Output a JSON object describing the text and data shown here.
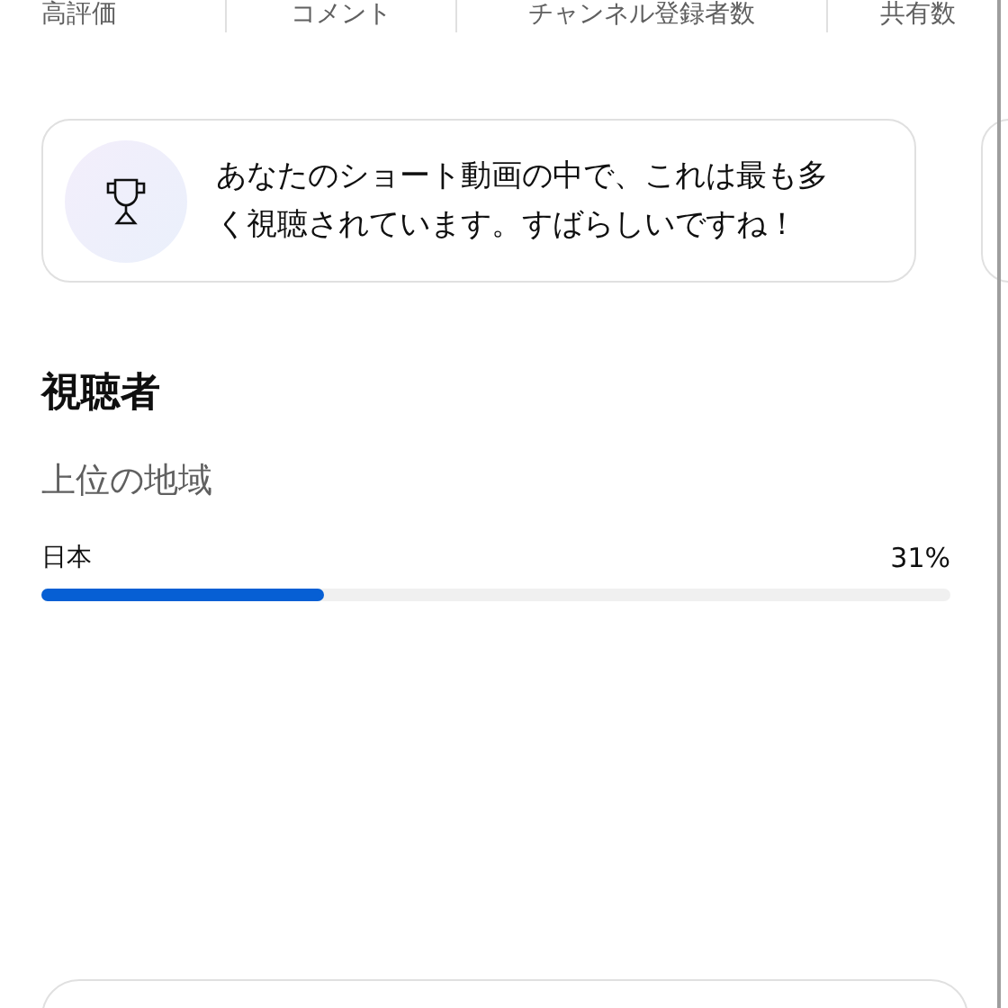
{
  "metric_tabs": [
    {
      "label": "高評価"
    },
    {
      "label": "コメント"
    },
    {
      "label": "チャンネル登録者数"
    },
    {
      "label": "共有数"
    }
  ],
  "highlight_card": {
    "text": "あなたのショート動画の中で、これは最も多く視聴されています。すばらしいですね！"
  },
  "audience": {
    "title": "視聴者",
    "subtitle": "上位の地域",
    "regions": [
      {
        "name": "日本",
        "value": "31%",
        "level": 0.31
      }
    ]
  }
}
